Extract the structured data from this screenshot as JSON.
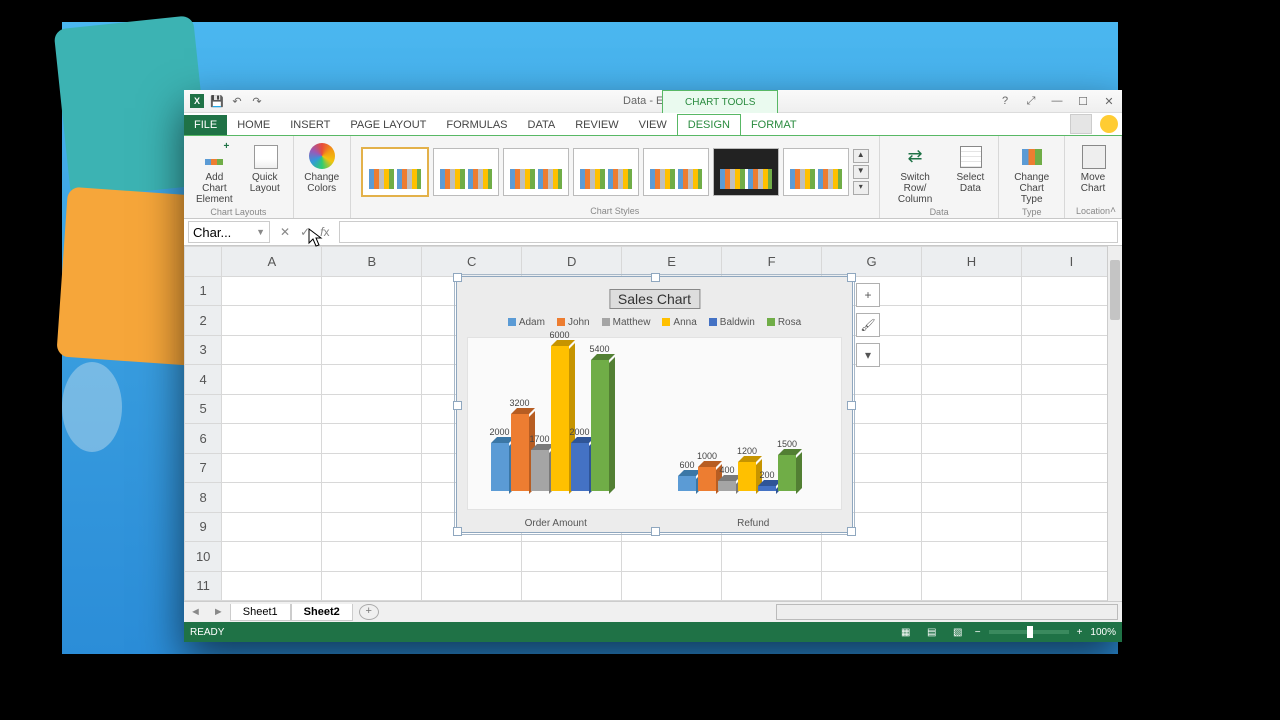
{
  "app": {
    "title": "Data - Excel",
    "chart_tools": "CHART TOOLS"
  },
  "qat": {
    "save": "💾",
    "undo": "↶",
    "redo": "↷"
  },
  "winctl": {
    "help": "?",
    "fullscr": "⤢",
    "min": "—",
    "max": "☐",
    "close": "✕"
  },
  "tabs": {
    "file": "FILE",
    "home": "HOME",
    "insert": "INSERT",
    "page": "PAGE LAYOUT",
    "formulas": "FORMULAS",
    "data": "DATA",
    "review": "REVIEW",
    "view": "VIEW",
    "design": "DESIGN",
    "format": "FORMAT"
  },
  "ribbon": {
    "add_element": "Add Chart\nElement",
    "quick": "Quick\nLayout",
    "colors": "Change\nColors",
    "grp_layouts": "Chart Layouts",
    "grp_styles": "Chart Styles",
    "swap": "Switch Row/\nColumn",
    "seldata": "Select\nData",
    "grp_data": "Data",
    "chtype": "Change\nChart Type",
    "grp_type": "Type",
    "move": "Move\nChart",
    "grp_loc": "Location"
  },
  "namebox": "Char...",
  "cols": [
    "A",
    "B",
    "C",
    "D",
    "E",
    "F",
    "G",
    "H",
    "I"
  ],
  "rows": [
    "1",
    "2",
    "3",
    "4",
    "5",
    "6",
    "7",
    "8",
    "9",
    "10",
    "11"
  ],
  "chart_data": {
    "type": "bar",
    "title": "Sales Chart",
    "categories": [
      "Order Amount",
      "Refund"
    ],
    "series": [
      {
        "name": "Adam",
        "color": "#5b9bd5",
        "dark": "#3b77a6",
        "values": [
          2000,
          600
        ]
      },
      {
        "name": "John",
        "color": "#ed7d31",
        "dark": "#b75d22",
        "values": [
          3200,
          1000
        ]
      },
      {
        "name": "Matthew",
        "color": "#a5a5a5",
        "dark": "#7a7a7a",
        "values": [
          1700,
          400
        ]
      },
      {
        "name": "Anna",
        "color": "#ffc000",
        "dark": "#c69400",
        "values": [
          6000,
          1200
        ]
      },
      {
        "name": "Baldwin",
        "color": "#4472c4",
        "dark": "#2f5597",
        "values": [
          2000,
          200
        ]
      },
      {
        "name": "Rosa",
        "color": "#70ad47",
        "dark": "#527f33",
        "values": [
          5400,
          1500
        ]
      }
    ],
    "ylim": [
      0,
      6200
    ]
  },
  "chart_btns": {
    "plus": "+",
    "brush": "🖌",
    "filter": "▾"
  },
  "sheets": {
    "s1": "Sheet1",
    "s2": "Sheet2",
    "add": "+"
  },
  "status": {
    "ready": "READY",
    "zoom": "100%",
    "minus": "−",
    "plus": "+"
  }
}
